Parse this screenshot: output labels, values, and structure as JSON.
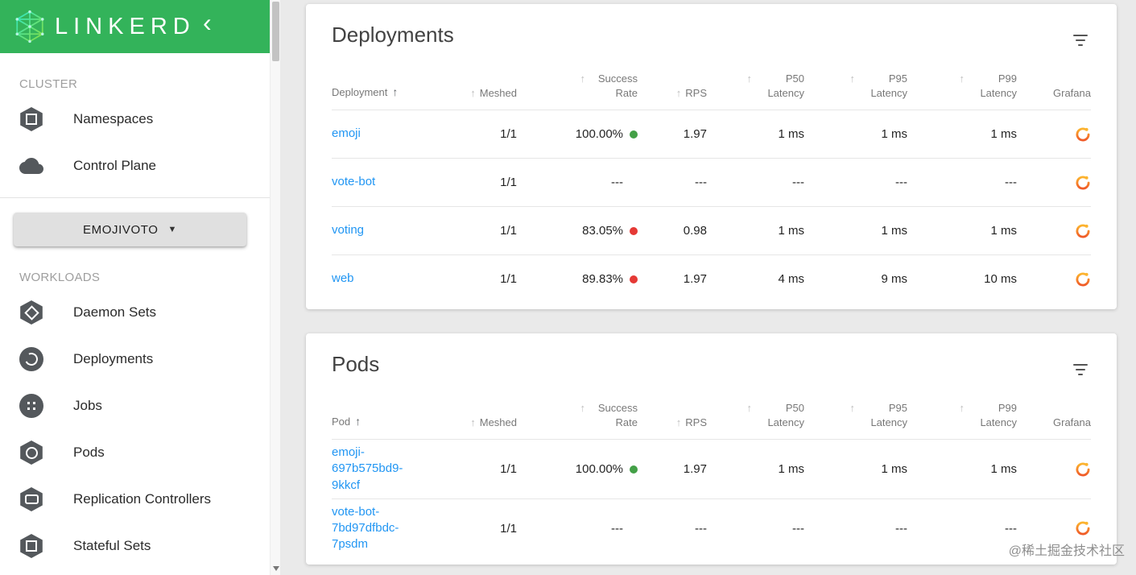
{
  "colors": {
    "brand_green": "#33b35a",
    "link_blue": "#2196f3",
    "status_good": "#43a047",
    "status_bad": "#e53935",
    "grafana_orange": "#f05a28"
  },
  "icons": {
    "sort_asc": "↑",
    "caret_down": "▼",
    "chevron_left": "‹"
  },
  "sidebar": {
    "logo_text": "LINKERD",
    "cluster": {
      "heading": "CLUSTER",
      "items": [
        {
          "label": "Namespaces"
        },
        {
          "label": "Control Plane"
        }
      ]
    },
    "namespace_selector": {
      "label": "EMOJIVOTO"
    },
    "workloads": {
      "heading": "WORKLOADS",
      "items": [
        {
          "label": "Daemon Sets"
        },
        {
          "label": "Deployments"
        },
        {
          "label": "Jobs"
        },
        {
          "label": "Pods"
        },
        {
          "label": "Replication Controllers"
        },
        {
          "label": "Stateful Sets"
        }
      ]
    }
  },
  "deployments": {
    "title": "Deployments",
    "columns": {
      "name": "Deployment",
      "meshed": "Meshed",
      "success": "Success Rate",
      "rps": "RPS",
      "p50": "P50 Latency",
      "p95": "P95 Latency",
      "p99": "P99 Latency",
      "grafana": "Grafana"
    },
    "rows": [
      {
        "name": "emoji",
        "meshed": "1/1",
        "success": "100.00%",
        "status": "good",
        "rps": "1.97",
        "p50": "1 ms",
        "p95": "1 ms",
        "p99": "1 ms"
      },
      {
        "name": "vote-bot",
        "meshed": "1/1",
        "success": "---",
        "status": "none",
        "rps": "---",
        "p50": "---",
        "p95": "---",
        "p99": "---"
      },
      {
        "name": "voting",
        "meshed": "1/1",
        "success": "83.05%",
        "status": "bad",
        "rps": "0.98",
        "p50": "1 ms",
        "p95": "1 ms",
        "p99": "1 ms"
      },
      {
        "name": "web",
        "meshed": "1/1",
        "success": "89.83%",
        "status": "bad",
        "rps": "1.97",
        "p50": "4 ms",
        "p95": "9 ms",
        "p99": "10 ms"
      }
    ]
  },
  "pods": {
    "title": "Pods",
    "columns": {
      "name": "Pod",
      "meshed": "Meshed",
      "success": "Success Rate",
      "rps": "RPS",
      "p50": "P50 Latency",
      "p95": "P95 Latency",
      "p99": "P99 Latency",
      "grafana": "Grafana"
    },
    "rows": [
      {
        "name": "emoji-697b575bd9-9kkcf",
        "meshed": "1/1",
        "success": "100.00%",
        "status": "good",
        "rps": "1.97",
        "p50": "1 ms",
        "p95": "1 ms",
        "p99": "1 ms"
      },
      {
        "name": "vote-bot-7bd97dfbdc-7psdm",
        "meshed": "1/1",
        "success": "---",
        "status": "none",
        "rps": "---",
        "p50": "---",
        "p95": "---",
        "p99": "---"
      }
    ]
  },
  "watermark": "@稀土掘金技术社区"
}
